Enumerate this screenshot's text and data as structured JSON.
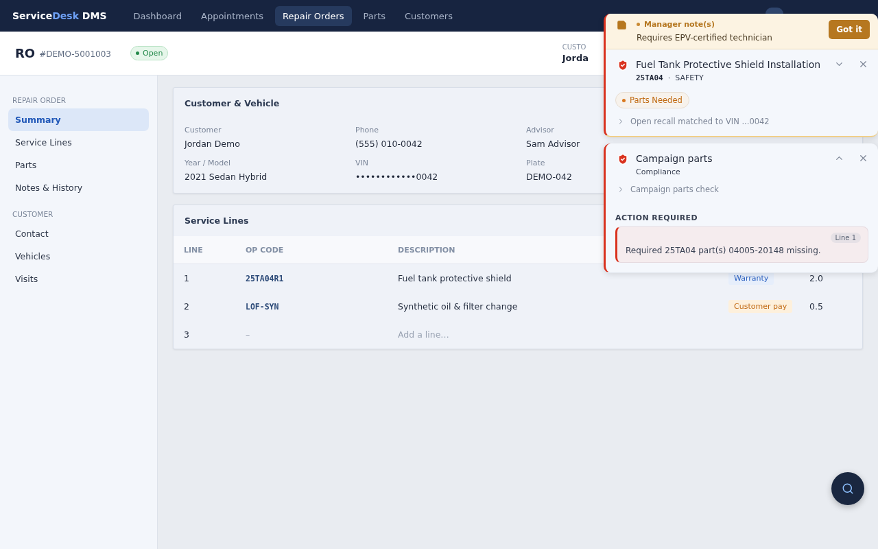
{
  "topbar": {
    "brand": {
      "first": "Service",
      "accent": "Desk",
      "last": " DMS"
    },
    "nav": [
      {
        "label": "Dashboard",
        "selected": false
      },
      {
        "label": "Appointments",
        "selected": false
      },
      {
        "label": "Repair Orders",
        "selected": true
      },
      {
        "label": "Parts",
        "selected": false
      },
      {
        "label": "Customers",
        "selected": false
      }
    ]
  },
  "header": {
    "title": "RO",
    "number": "#DEMO-5001003",
    "status": "Open",
    "customer_label": "CUSTO",
    "customer_value": "Jorda"
  },
  "sidebar": {
    "sections": [
      {
        "title": "REPAIR ORDER",
        "items": [
          {
            "label": "Summary",
            "selected": true
          },
          {
            "label": "Service Lines",
            "selected": false
          },
          {
            "label": "Parts",
            "selected": false
          },
          {
            "label": "Notes & History",
            "selected": false
          }
        ]
      },
      {
        "title": "CUSTOMER",
        "items": [
          {
            "label": "Contact",
            "selected": false
          },
          {
            "label": "Vehicles",
            "selected": false
          },
          {
            "label": "Visits",
            "selected": false
          }
        ]
      }
    ]
  },
  "customer_vehicle": {
    "title": "Customer & Vehicle",
    "fields": [
      {
        "label": "Customer",
        "value": "Jordan Demo"
      },
      {
        "label": "Phone",
        "value": "(555) 010-0042"
      },
      {
        "label": "Advisor",
        "value": "Sam Advisor"
      },
      {
        "label": "Year / Model",
        "value": "2021 Sedan Hybrid"
      },
      {
        "label": "VIN",
        "value": "••••••••••••0042"
      },
      {
        "label": "Plate",
        "value": "DEMO-042"
      }
    ]
  },
  "service_lines": {
    "title": "Service Lines",
    "columns": [
      "LINE",
      "OP CODE",
      "DESCRIPTION"
    ],
    "rows": [
      {
        "line": "1",
        "op_code": "25TA04R1",
        "description": "Fuel tank protective shield",
        "pay_type": {
          "label": "Warranty",
          "kind": "warranty"
        },
        "column_5": "2.0"
      },
      {
        "line": "2",
        "op_code": "LOF-SYN",
        "description": "Synthetic oil & filter change",
        "pay_type": {
          "label": "Customer pay",
          "kind": "customer"
        },
        "column_5": "0.5"
      },
      {
        "line": "3",
        "op_code": "–",
        "description": "Add a line…",
        "kind": "placeholder"
      }
    ]
  },
  "alerts": {
    "manager_note": {
      "title": "Manager note(s)",
      "text": "Requires EPV-certified technician",
      "button": "Got it"
    },
    "cards": [
      {
        "title": "Fuel Tank Protective Shield Installation",
        "code": "25TA04",
        "separator": "·",
        "category": "SAFETY",
        "expanded": false,
        "badge": "Parts Needed",
        "detail": "Open recall matched to VIN ...0042"
      },
      {
        "title": "Campaign parts",
        "category": "Compliance",
        "expanded": true,
        "detail": "Campaign parts check",
        "action_title": "ACTION REQUIRED",
        "actions": [
          {
            "tag": "Line 1",
            "text": "Required 25TA04 part(s) 04005-20148 missing."
          }
        ]
      }
    ]
  }
}
